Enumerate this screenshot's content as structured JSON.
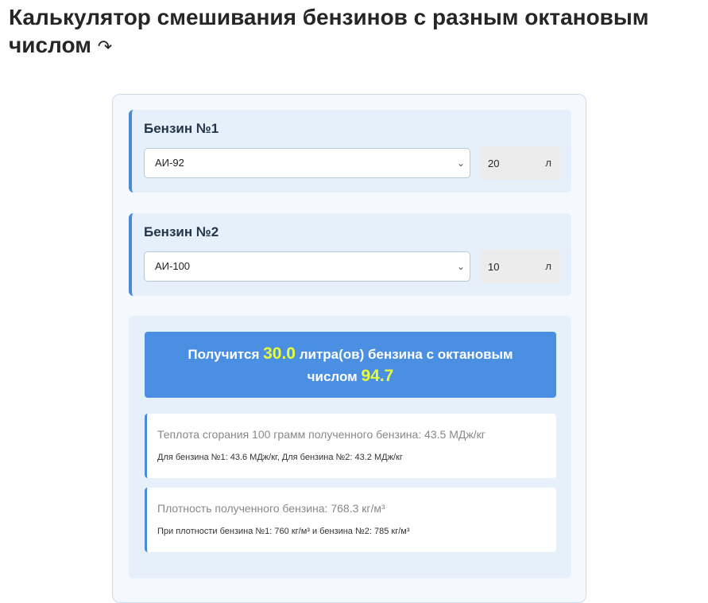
{
  "title": "Калькулятор смешивания бензинов с разным октановым числом",
  "title_icon": "↷",
  "fuel1": {
    "heading": "Бензин №1",
    "grade": "АИ-92",
    "volume": "20",
    "unit": "л"
  },
  "fuel2": {
    "heading": "Бензин №2",
    "grade": "АИ-100",
    "volume": "10",
    "unit": "л"
  },
  "result": {
    "prefix": "Получится",
    "liters": "30.0",
    "middle": "литра(ов) бензина с октановым числом",
    "octane": "94.7",
    "heat_main": "Теплота сгорания 100 грамм полученного бензина: 43.5 МДж/кг",
    "heat_sub": "Для бензина №1: 43.6 МДж/кг, Для бензина №2: 43.2 МДж/кг",
    "density_main": "Плотность полученного бензина: 768.3 кг/м³",
    "density_sub": "При плотности бензина №1: 760 кг/м³ и бензина №2: 785 кг/м³"
  },
  "colors": {
    "accent": "#4a8bd6",
    "banner": "#4a8fe2",
    "highlight": "#e8ff3a"
  }
}
